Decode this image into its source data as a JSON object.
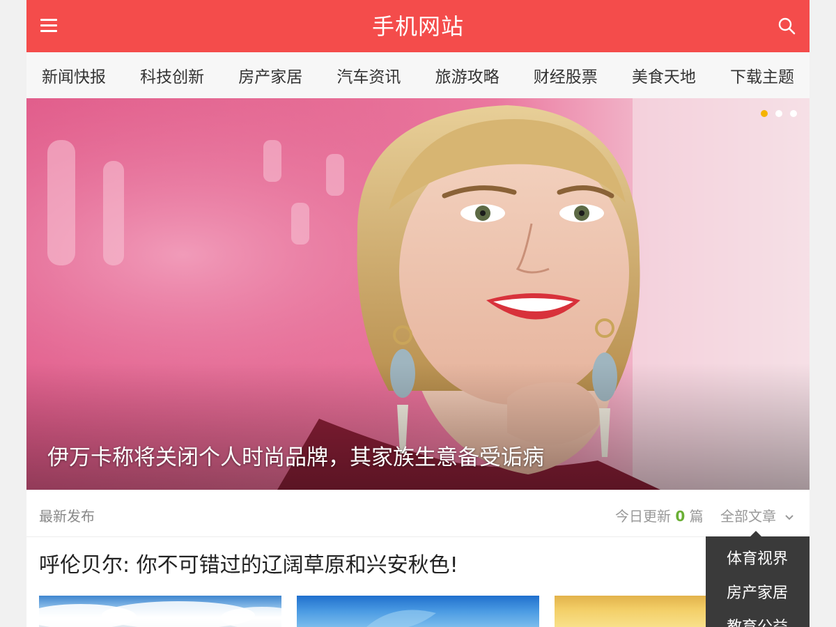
{
  "header": {
    "title": "手机网站",
    "menu_icon": "hamburger-menu-icon",
    "search_icon": "search-icon",
    "background_color": "#f44c4b"
  },
  "categories": [
    "新闻快报",
    "科技创新",
    "房产家居",
    "汽车资讯",
    "旅游攻略",
    "财经股票",
    "美食天地",
    "下载主题"
  ],
  "banner": {
    "caption": "伊万卡称将关闭个人时尚品牌，其家族生意备受诟病",
    "slides_total": 3,
    "active_slide": 1,
    "active_dot_color": "#f5b400"
  },
  "latest": {
    "label": "最新发布",
    "today_prefix": "今日更新",
    "today_count": "0",
    "today_suffix": "篇",
    "all_articles": "全部文章",
    "count_color": "#6aaf35"
  },
  "dropdown": {
    "items": [
      "体育视界",
      "房产家居",
      "教育公益"
    ]
  },
  "article": {
    "title": "呼伦贝尔: 你不可错过的辽阔草原和兴安秋色!"
  }
}
